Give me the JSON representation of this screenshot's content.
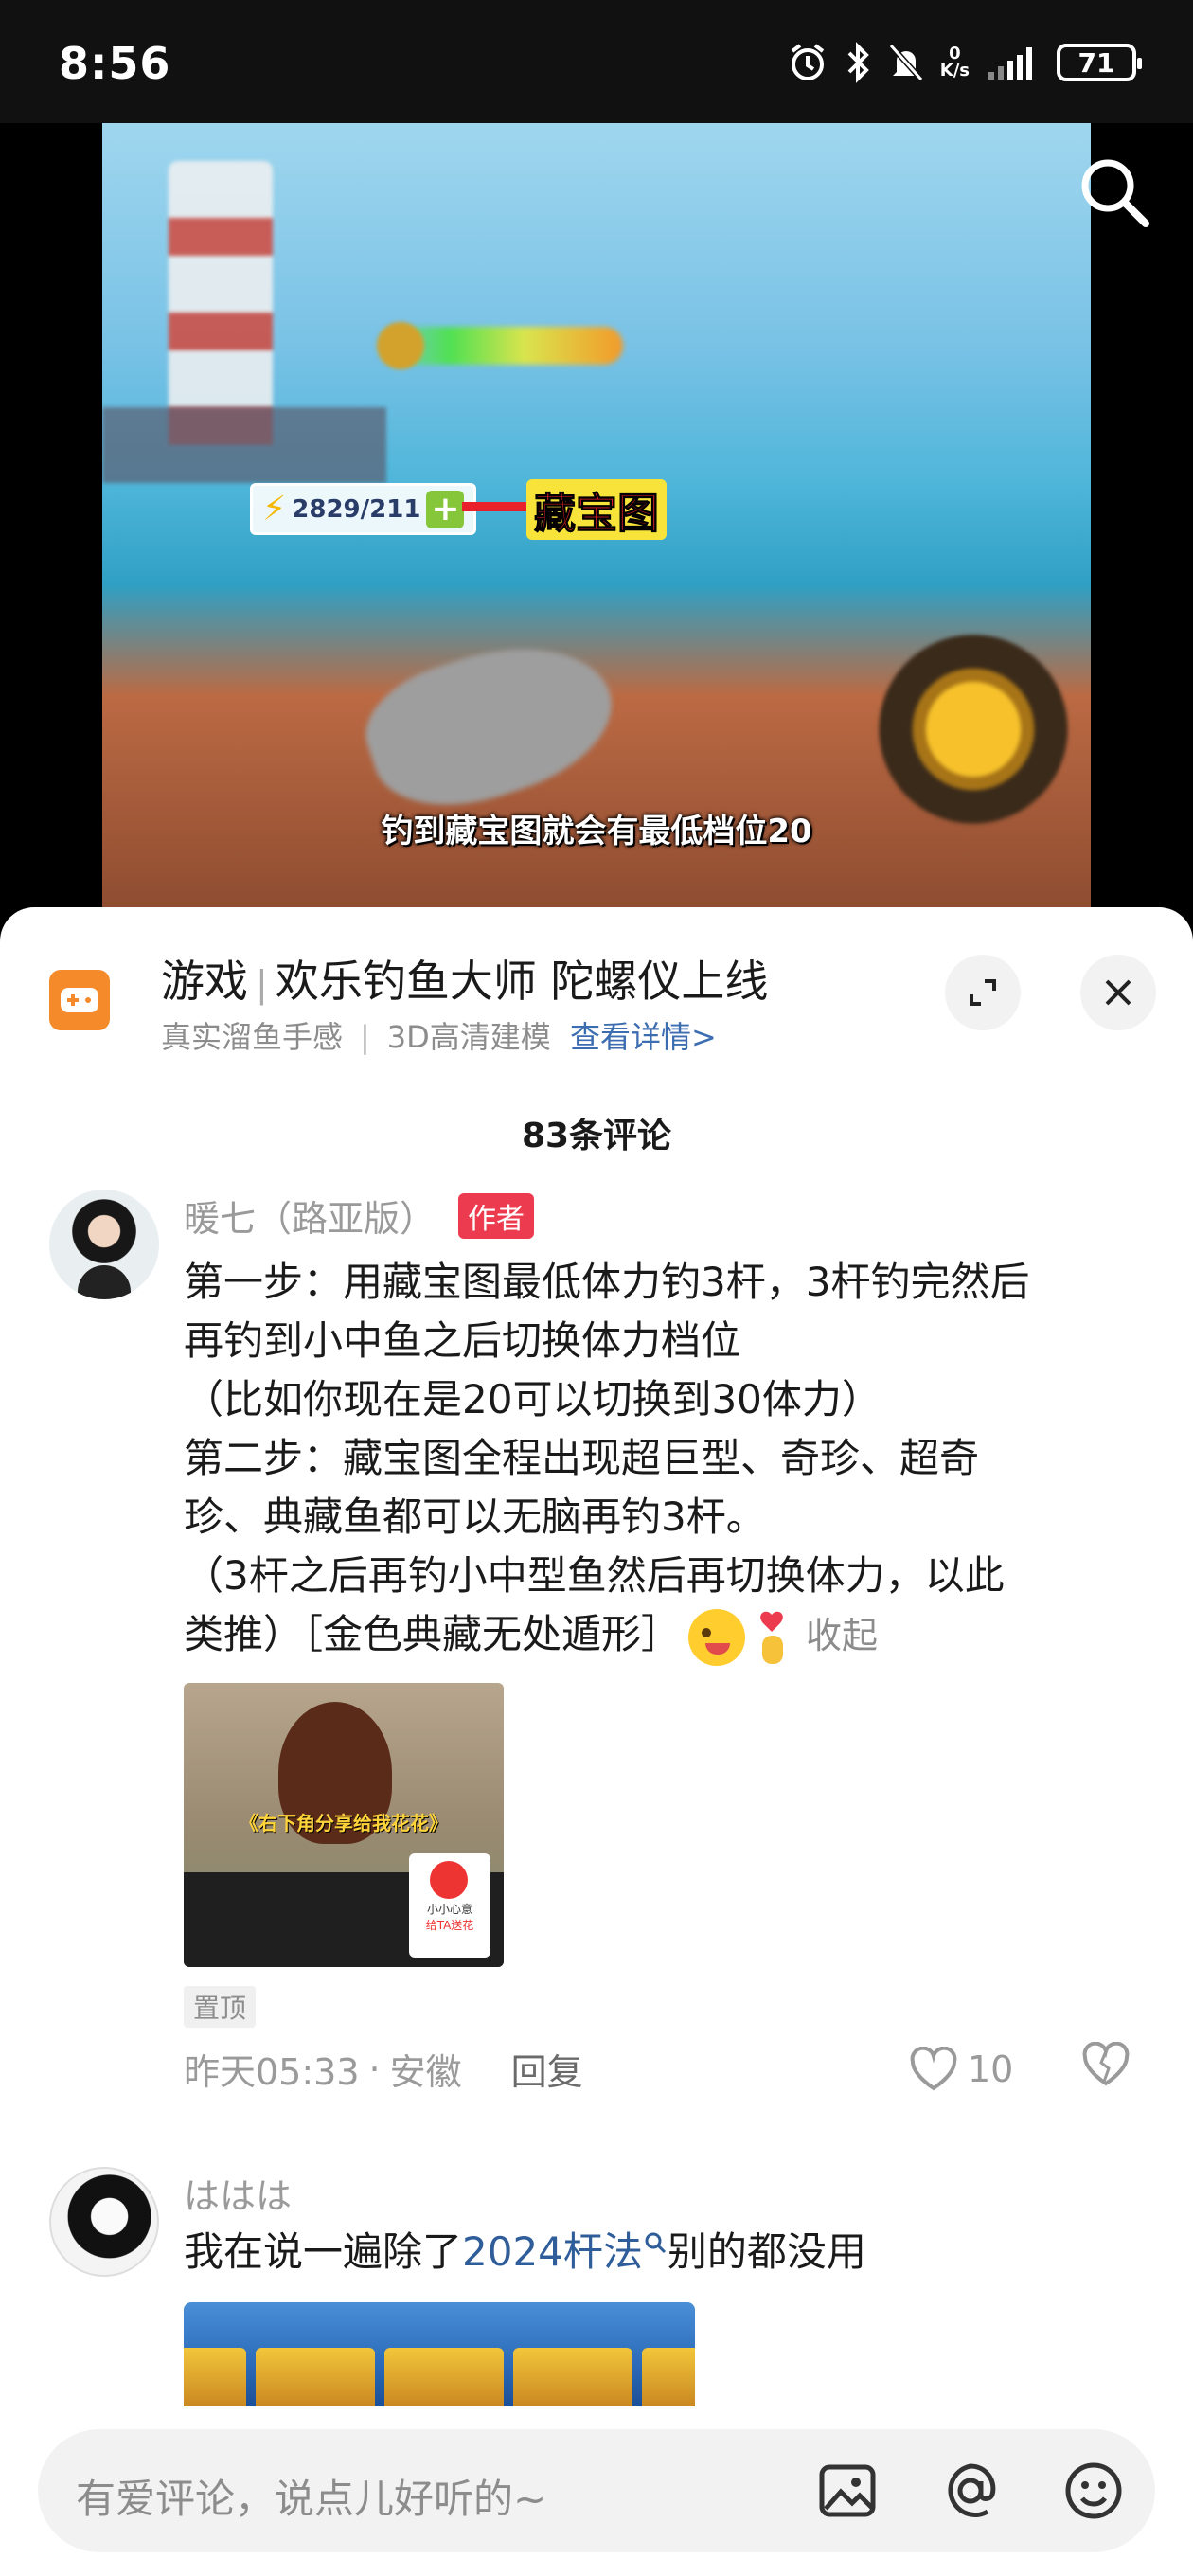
{
  "status_bar": {
    "time": "8:56",
    "net_speed_value": "0",
    "net_speed_unit": "K/s",
    "battery": "71"
  },
  "video": {
    "stamina_value": "2829/211",
    "treasure_label": "藏宝图",
    "subtitle": "钓到藏宝图就会有最低档位20"
  },
  "game_banner": {
    "category": "游戏",
    "title": "欢乐钓鱼大师 陀螺仪上线",
    "tag1": "真实溜鱼手感",
    "tag2": "3D高清建模",
    "details_link": "查看详情>"
  },
  "comments_header": {
    "count_label": "83条评论"
  },
  "comments": [
    {
      "username": "暖七（路亚版）",
      "badge": "作者",
      "lines": [
        "第一步：用藏宝图最低体力钓3杆，3杆钓完然后",
        "再钓到小中鱼之后切换体力档位",
        "（比如你现在是20可以切换到30体力）",
        "第二步：藏宝图全程出现超巨型、奇珍、超奇",
        "珍、典藏鱼都可以无脑再钓3杆。",
        "（3杆之后再钓小中型鱼然后再切换体力，以此",
        "类推）［金色典藏无处遁形］"
      ],
      "collapse_label": "收起",
      "image_caption": "《右下角分享给我花花》",
      "image_card_text": "小小心意",
      "image_card_button": "给TA送花",
      "pinned_label": "置顶",
      "time": "昨天05:33",
      "location": "安徽",
      "reply_label": "回复",
      "likes": "10"
    },
    {
      "username": "ははは",
      "text_before": "我在说一遍除了",
      "text_link": "2024杆法",
      "text_after": "别的都没用"
    }
  ],
  "input_bar": {
    "placeholder": "有爱评论，说点儿好听的~"
  }
}
